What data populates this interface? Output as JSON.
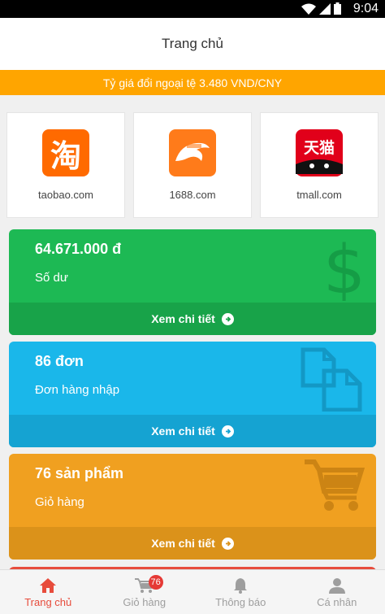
{
  "status_bar": {
    "time": "9:04",
    "icons": [
      "wifi-icon",
      "signal-icon",
      "battery-icon"
    ]
  },
  "header": {
    "title": "Trang chủ"
  },
  "rate_banner": {
    "text": "Tỷ giá đổi ngoại tệ 3.480 VND/CNY"
  },
  "sites": [
    {
      "label": "taobao.com",
      "logo_glyph": "淘",
      "color": "#ff6a00"
    },
    {
      "label": "1688.com",
      "logo_glyph": "",
      "color": "#ff7b1a"
    },
    {
      "label": "tmall.com",
      "logo_glyph": "天猫",
      "color": "#e1001a"
    }
  ],
  "cards": [
    {
      "value": "64.671.000 đ",
      "sub": "Số dư",
      "action": "Xem chi tiết",
      "color": "#1db954",
      "bottom_color": "#18a349",
      "icon": "dollar-icon"
    },
    {
      "value": "86 đơn",
      "sub": "Đơn hàng nhập",
      "action": "Xem chi tiết",
      "color": "#1ab7ea",
      "bottom_color": "#15a3d2",
      "icon": "copy-icon"
    },
    {
      "value": "76 sản phẩm",
      "sub": "Giỏ hàng",
      "action": "Xem chi tiết",
      "color": "#f0a020",
      "bottom_color": "#db921a",
      "icon": "cart-icon"
    }
  ],
  "tabs": [
    {
      "label": "Trang chủ",
      "icon": "home-icon",
      "active": true
    },
    {
      "label": "Giỏ hàng",
      "icon": "cart-icon",
      "badge": "76"
    },
    {
      "label": "Thông báo",
      "icon": "bell-icon"
    },
    {
      "label": "Cá nhân",
      "icon": "user-icon"
    }
  ],
  "accent": "#e74c3c"
}
